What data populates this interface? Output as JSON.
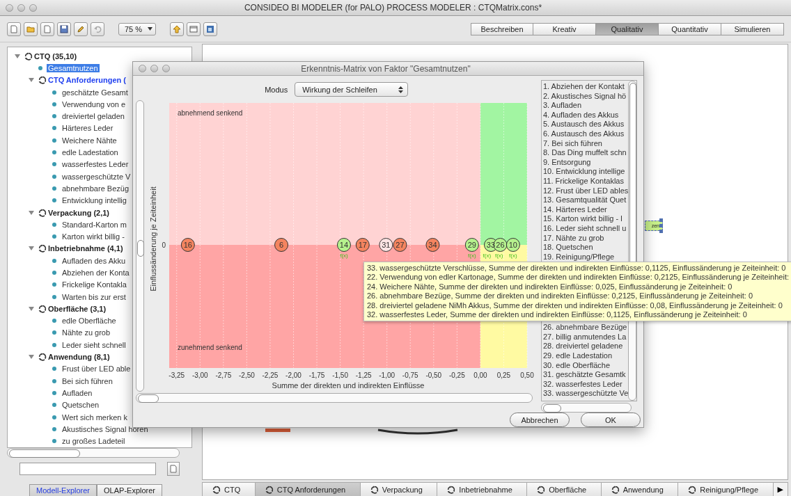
{
  "window": {
    "title": "CONSIDEO BI MODELER (for PALO) PROCESS MODELER : CTQMatrix.cons*"
  },
  "toolbar": {
    "zoom": "75 %",
    "modes": [
      {
        "label": "Beschreiben",
        "selected": false
      },
      {
        "label": "Kreativ",
        "selected": false
      },
      {
        "label": "Qualitativ",
        "selected": true
      },
      {
        "label": "Quantitativ",
        "selected": false
      },
      {
        "label": "Simulieren",
        "selected": false
      }
    ]
  },
  "tree": [
    {
      "label": "CTQ (35,10)",
      "kind": "group",
      "expanded": true,
      "highlighted": false,
      "selected": false,
      "children": [
        {
          "label": "Gesamtnutzen",
          "kind": "leaf",
          "selected": true
        },
        {
          "label": "CTQ Anforderungen (",
          "kind": "group",
          "expanded": true,
          "highlighted": true,
          "selected": false,
          "children": [
            {
              "label": "geschätzte Gesamt",
              "kind": "leaf",
              "selected": false
            },
            {
              "label": "Verwendung von e",
              "kind": "leaf",
              "selected": false
            },
            {
              "label": "dreiviertel geladen",
              "kind": "leaf",
              "selected": false
            },
            {
              "label": "Härteres Leder",
              "kind": "leaf",
              "selected": false
            },
            {
              "label": "Weichere Nähte",
              "kind": "leaf",
              "selected": false
            },
            {
              "label": "edle Ladestation",
              "kind": "leaf",
              "selected": false
            },
            {
              "label": "wasserfestes Leder",
              "kind": "leaf",
              "selected": false
            },
            {
              "label": "wassergeschützte V",
              "kind": "leaf",
              "selected": false
            },
            {
              "label": "abnehmbare Bezüg",
              "kind": "leaf",
              "selected": false
            },
            {
              "label": "Entwicklung intellig",
              "kind": "leaf",
              "selected": false
            }
          ]
        },
        {
          "label": "Verpackung (2,1)",
          "kind": "group",
          "expanded": true,
          "highlighted": false,
          "selected": false,
          "children": [
            {
              "label": "Standard-Karton m",
              "kind": "leaf",
              "selected": false
            },
            {
              "label": "Karton wirkt billig -",
              "kind": "leaf",
              "selected": false
            }
          ]
        },
        {
          "label": "Inbetriebnahme (4,1)",
          "kind": "group",
          "expanded": true,
          "highlighted": false,
          "selected": false,
          "children": [
            {
              "label": "Aufladen des Akku",
              "kind": "leaf",
              "selected": false
            },
            {
              "label": "Abziehen der Konta",
              "kind": "leaf",
              "selected": false
            },
            {
              "label": "Frickelige Kontakla",
              "kind": "leaf",
              "selected": false
            },
            {
              "label": "Warten bis zur erst",
              "kind": "leaf",
              "selected": false
            }
          ]
        },
        {
          "label": "Oberfläche (3,1)",
          "kind": "group",
          "expanded": true,
          "highlighted": false,
          "selected": false,
          "children": [
            {
              "label": "edle Oberfläche",
              "kind": "leaf",
              "selected": false
            },
            {
              "label": "Nähte zu grob",
              "kind": "leaf",
              "selected": false
            },
            {
              "label": "Leder sieht schnell",
              "kind": "leaf",
              "selected": false
            }
          ]
        },
        {
          "label": "Anwendung (8,1)",
          "kind": "group",
          "expanded": true,
          "highlighted": false,
          "selected": false,
          "children": [
            {
              "label": "Frust über LED able",
              "kind": "leaf",
              "selected": false
            },
            {
              "label": "Bei sich führen",
              "kind": "leaf",
              "selected": false
            },
            {
              "label": "Aufladen",
              "kind": "leaf",
              "selected": false
            },
            {
              "label": "Quetschen",
              "kind": "leaf",
              "selected": false
            },
            {
              "label": "Wert sich merken k",
              "kind": "leaf",
              "selected": false
            },
            {
              "label": "Akustisches Signal hören",
              "kind": "leaf",
              "selected": false
            },
            {
              "label": "zu großes Ladeteil",
              "kind": "leaf",
              "selected": false
            }
          ]
        }
      ]
    }
  ],
  "explorer_tabs": [
    {
      "label": "Modell-Explorer",
      "selected": true
    },
    {
      "label": "OLAP-Explorer",
      "selected": false
    }
  ],
  "canvas": {
    "node": {
      "label": "zen",
      "selected": true
    }
  },
  "bottom_tabs": [
    {
      "label": "CTQ",
      "selected": false
    },
    {
      "label": "CTQ Anforderungen",
      "selected": true
    },
    {
      "label": "Verpackung",
      "selected": false
    },
    {
      "label": "Inbetriebnahme",
      "selected": false
    },
    {
      "label": "Oberfläche",
      "selected": false
    },
    {
      "label": "Anwendung",
      "selected": false
    },
    {
      "label": "Reinigung/Pflege",
      "selected": false
    }
  ],
  "bottom_tabs_more": "▶",
  "dialog": {
    "title": "Erkenntnis-Matrix von Faktor \"Gesamtnutzen\"",
    "mode_label": "Modus",
    "mode_value": "Wirkung der Schleifen",
    "matrix": {
      "xlabel": "Summe der direkten und indirekten Einflüsse",
      "ylabel": "Einflussänderung je Zeiteinheit",
      "xticks": [
        "-3,25",
        "-3,00",
        "-2,75",
        "-2,50",
        "-2,25",
        "-2,00",
        "-1,75",
        "-1,50",
        "-1,25",
        "-1,00",
        "-0,75",
        "-0,50",
        "-0,25",
        "0,00",
        "0,25",
        "0,50"
      ],
      "ytick": "0",
      "quadrant_labels": {
        "upper_left": "abnehmend senkend",
        "lower_left": "zunehmend senkend"
      },
      "points": [
        {
          "label": "16",
          "color": "#f4845f"
        },
        {
          "label": "6",
          "color": "#f4845f"
        },
        {
          "label": "14",
          "color": "#b6f28e"
        },
        {
          "label": "17",
          "color": "#f4845f"
        },
        {
          "label": "31",
          "color": "#fde4e4"
        },
        {
          "label": "27",
          "color": "#f4845f"
        },
        {
          "label": "34",
          "color": "#f4845f"
        },
        {
          "label": "29",
          "color": "#b6f28e"
        },
        {
          "label": "33",
          "color": "#b6f28e"
        },
        {
          "label": "26",
          "color": "#b6f28e"
        },
        {
          "label": "10",
          "color": "#b6f28e"
        }
      ],
      "formula_marks": [
        "f(x)",
        "f(x)",
        "f(x)",
        "f(x)",
        "f(x)"
      ]
    },
    "list_top": [
      "1. Abziehen der Kontakt",
      "2. Akustisches Signal hö",
      "3. Aufladen",
      "4. Aufladen des Akkus",
      "5. Austausch des Akkus",
      "6. Austausch des Akkus",
      "7. Bei sich führen",
      "8. Das Ding muffelt schn",
      "9. Entsorgung",
      "10. Entwicklung intellige",
      "11. Frickelige Kontaklas",
      "12. Frust über LED ables",
      "13. Gesamtqualität Quet",
      "14. Härteres Leder",
      "15. Karton wirkt billig - l",
      "16. Leder sieht schnell u",
      "17. Nähte zu grob",
      "18. Quetschen",
      "19. Reinigung/Pflege"
    ],
    "list_bottom": [
      "26. abnehmbare Bezüge",
      "27. billig anmutendes La",
      "28. dreiviertel geladene",
      "29. edle Ladestation",
      "30. edle Oberfläche",
      "31. geschätzte Gesamtk",
      "32. wasserfestes Leder",
      "33. wassergeschützte Ve"
    ],
    "buttons": [
      "Abbrechen",
      "OK"
    ]
  },
  "tooltip": [
    "33. wassergeschützte Verschlüsse, Summe der direkten und indirekten Einflüsse: 0,1125, Einflussänderung je Zeiteinheit: 0",
    "22. Verwendung von edler Kartonage, Summe der direkten und indirekten Einflüsse: 0,2125, Einflussänderung je Zeiteinheit:",
    "24. Weichere Nähte, Summe der direkten und indirekten Einflüsse: 0,025, Einflussänderung je Zeiteinheit: 0",
    "26. abnehmbare Bezüge, Summe der direkten und indirekten Einflüsse: 0,2125, Einflussänderung je Zeiteinheit: 0",
    "28. dreiviertel geladene NiMh Akkus, Summe der direkten und indirekten Einflüsse: 0,08, Einflussänderung je Zeiteinheit: 0",
    "32. wasserfestes Leder, Summe der direkten und indirekten Einflüsse: 0,1125, Einflussänderung je Zeiteinheit: 0"
  ]
}
